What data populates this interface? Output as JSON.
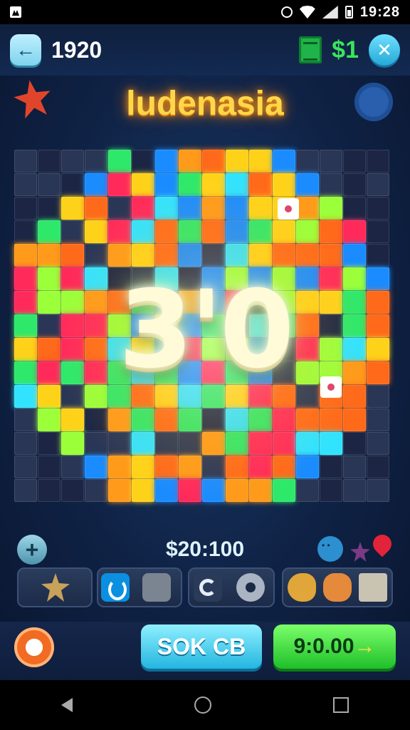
{
  "status_bar": {
    "time": "19:28"
  },
  "top_bar": {
    "score": "1920",
    "money": "$1"
  },
  "title": "ludenasia",
  "board": {
    "center_text": "3'0"
  },
  "info": {
    "text": "$20:100"
  },
  "buttons": {
    "blue_label": "SOK CB",
    "green_label": "9:0.00",
    "green_arrow": "→"
  },
  "colors": {
    "accent_green": "#39e65a",
    "title_gold": "#ffd84a",
    "button_blue": "#23b5e0",
    "button_green": "#1fbf2a"
  },
  "icons": [
    "back-arrow-icon",
    "money-icon",
    "close-icon",
    "star-icon",
    "gear-icon",
    "plus-icon",
    "face-icon",
    "map-pin-icon",
    "hook-icon",
    "box-icon",
    "wrench-icon",
    "cog-icon",
    "fish-icon",
    "cat-icon",
    "crate-icon",
    "spin-icon"
  ]
}
